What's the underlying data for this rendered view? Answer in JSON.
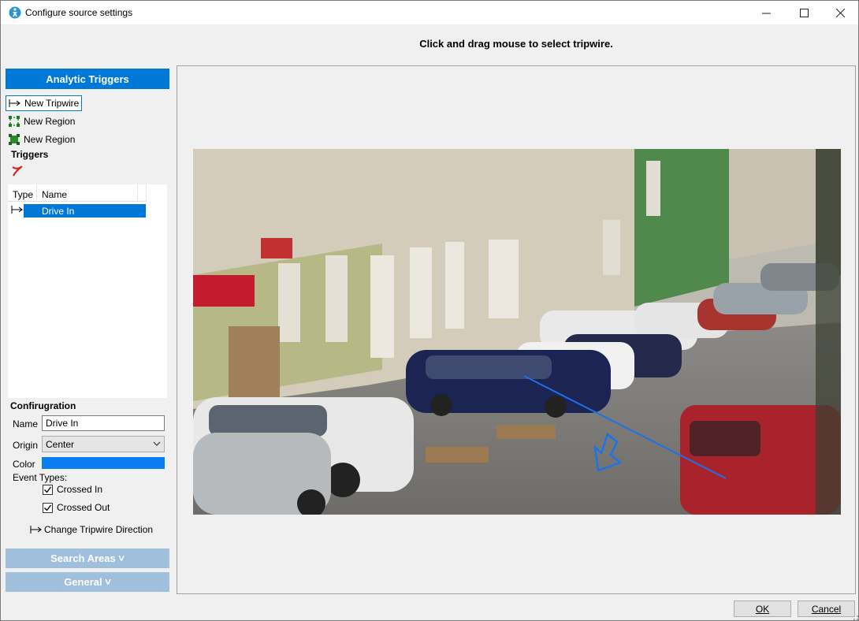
{
  "window": {
    "title": "Configure source settings"
  },
  "instruction": "Click and drag mouse to select tripwire.",
  "sidebar": {
    "header": "Analytic Triggers",
    "tools": [
      {
        "label": "New Tripwire",
        "icon": "tripwire-icon"
      },
      {
        "label": "New Region",
        "icon": "region-outline-icon"
      },
      {
        "label": "New Region",
        "icon": "region-filled-icon"
      }
    ],
    "triggers_label": "Triggers",
    "table": {
      "columns": [
        "Type",
        "Name"
      ],
      "rows": [
        {
          "type_icon": "tripwire-icon",
          "name": "Drive In"
        }
      ]
    },
    "config_label": "Confirugration",
    "config": {
      "name_label": "Name",
      "name_value": "Drive In",
      "origin_label": "Origin",
      "origin_value": "Center",
      "color_label": "Color",
      "color_value": "#0a7ef0",
      "event_types_label": "Event Types:",
      "crossed_in": "Crossed In",
      "crossed_out": "Crossed Out",
      "crossed_in_checked": true,
      "crossed_out_checked": true,
      "change_direction": "Change Tripwire Direction"
    },
    "search_areas": "Search Areas ˅",
    "general": "General ˅"
  },
  "buttons": {
    "ok": "OK",
    "cancel": "Cancel"
  },
  "colors": {
    "accent": "#0078d7",
    "collapsed_section": "#a0bfdc",
    "tripwire_line": "#1a73e8"
  }
}
